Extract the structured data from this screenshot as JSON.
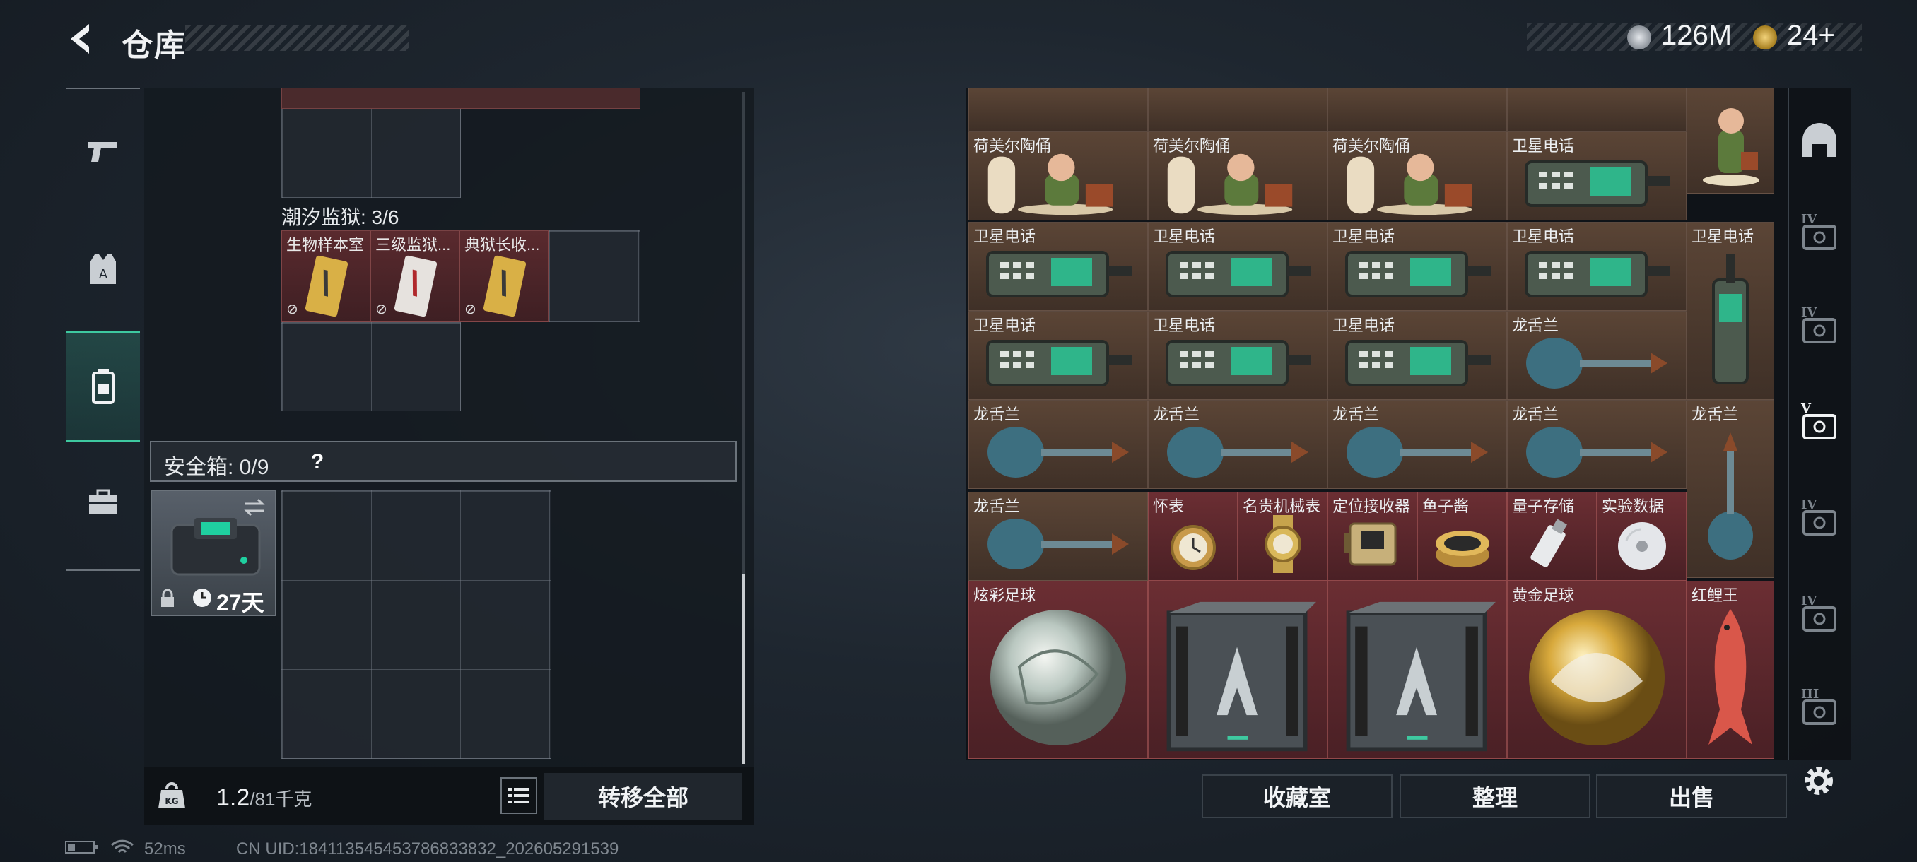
{
  "header": {
    "title": "仓库",
    "currency": [
      {
        "icon": "silver-coin-icon",
        "value": "126M"
      },
      {
        "icon": "gold-coin-icon",
        "value": "24+"
      }
    ]
  },
  "left_nav": [
    {
      "name": "weapon-tab",
      "icon": "pistol-icon",
      "active": false
    },
    {
      "name": "armor-tab",
      "icon": "vest-icon",
      "active": false
    },
    {
      "name": "backpack-tab",
      "icon": "backpack-icon",
      "active": true
    },
    {
      "name": "case-tab",
      "icon": "briefcase-icon",
      "active": false
    }
  ],
  "container": {
    "tide_prison_label": "潮汐监狱: 3/6",
    "keys": [
      {
        "label": "生物样本室",
        "color": "gold"
      },
      {
        "label": "三级监狱...",
        "color": "red"
      },
      {
        "label": "典狱长收...",
        "color": "gold"
      }
    ],
    "safe_box_label": "安全箱: 0/9",
    "safe_box_help": "?",
    "safe_box_days": "27天"
  },
  "bottom_left": {
    "weight_current": "1.2",
    "weight_max": "/81千克",
    "transfer_all": "转移全部"
  },
  "items_grid": [
    {
      "label": "荷美尔陶俑",
      "art": "figurine"
    },
    {
      "label": "荷美尔陶俑",
      "art": "figurine"
    },
    {
      "label": "荷美尔陶俑",
      "art": "figurine"
    },
    {
      "label": "卫星电话",
      "art": "phone"
    },
    {
      "label": "卫星电话",
      "art": "phone"
    },
    {
      "label": "卫星电话",
      "art": "phone"
    },
    {
      "label": "卫星电话",
      "art": "phone"
    },
    {
      "label": "卫星电话",
      "art": "phone"
    },
    {
      "label": "卫星电话",
      "art": "phone-tall"
    },
    {
      "label": "卫星电话",
      "art": "phone"
    },
    {
      "label": "卫星电话",
      "art": "phone"
    },
    {
      "label": "卫星电话",
      "art": "phone"
    },
    {
      "label": "龙舌兰",
      "art": "bottle"
    },
    {
      "label": "龙舌兰",
      "art": "bottle"
    },
    {
      "label": "龙舌兰",
      "art": "bottle"
    },
    {
      "label": "龙舌兰",
      "art": "bottle"
    },
    {
      "label": "龙舌兰",
      "art": "bottle"
    },
    {
      "label": "龙舌兰",
      "art": "bottle-tall"
    },
    {
      "label": "龙舌兰",
      "art": "bottle"
    },
    {
      "label": "怀表",
      "art": "watch"
    },
    {
      "label": "名贵机械表",
      "art": "wristwatch"
    },
    {
      "label": "定位接收器",
      "art": "receiver"
    },
    {
      "label": "鱼子酱",
      "art": "caviar"
    },
    {
      "label": "量子存储",
      "art": "usb"
    },
    {
      "label": "实验数据",
      "art": "disc"
    },
    {
      "label": "炫彩足球",
      "art": "ball-iridescent"
    },
    {
      "label": "",
      "art": "crate"
    },
    {
      "label": "",
      "art": "crate"
    },
    {
      "label": "黄金足球",
      "art": "ball-gold"
    },
    {
      "label": "红鲤王",
      "art": "fish"
    }
  ],
  "right_tabs": [
    {
      "name": "helmet-tab",
      "label": ""
    },
    {
      "name": "safe-iv-tab-1",
      "label": "IV"
    },
    {
      "name": "safe-iv-tab-2",
      "label": "IV"
    },
    {
      "name": "safe-v-tab",
      "label": "V"
    },
    {
      "name": "safe-iv-tab-3",
      "label": "IV"
    },
    {
      "name": "safe-iv-tab-4",
      "label": "IV"
    },
    {
      "name": "safe-iii-tab",
      "label": "III"
    }
  ],
  "bottom_right": {
    "collection": "收藏室",
    "sort": "整理",
    "sell": "出售"
  },
  "status": {
    "ping": "52ms",
    "uid": "CN UID:18411354545378683383​2_202605291539"
  },
  "colors": {
    "accent": "#3ec9a0",
    "item_brown": "#5b4536",
    "item_red": "#6b2e33"
  }
}
